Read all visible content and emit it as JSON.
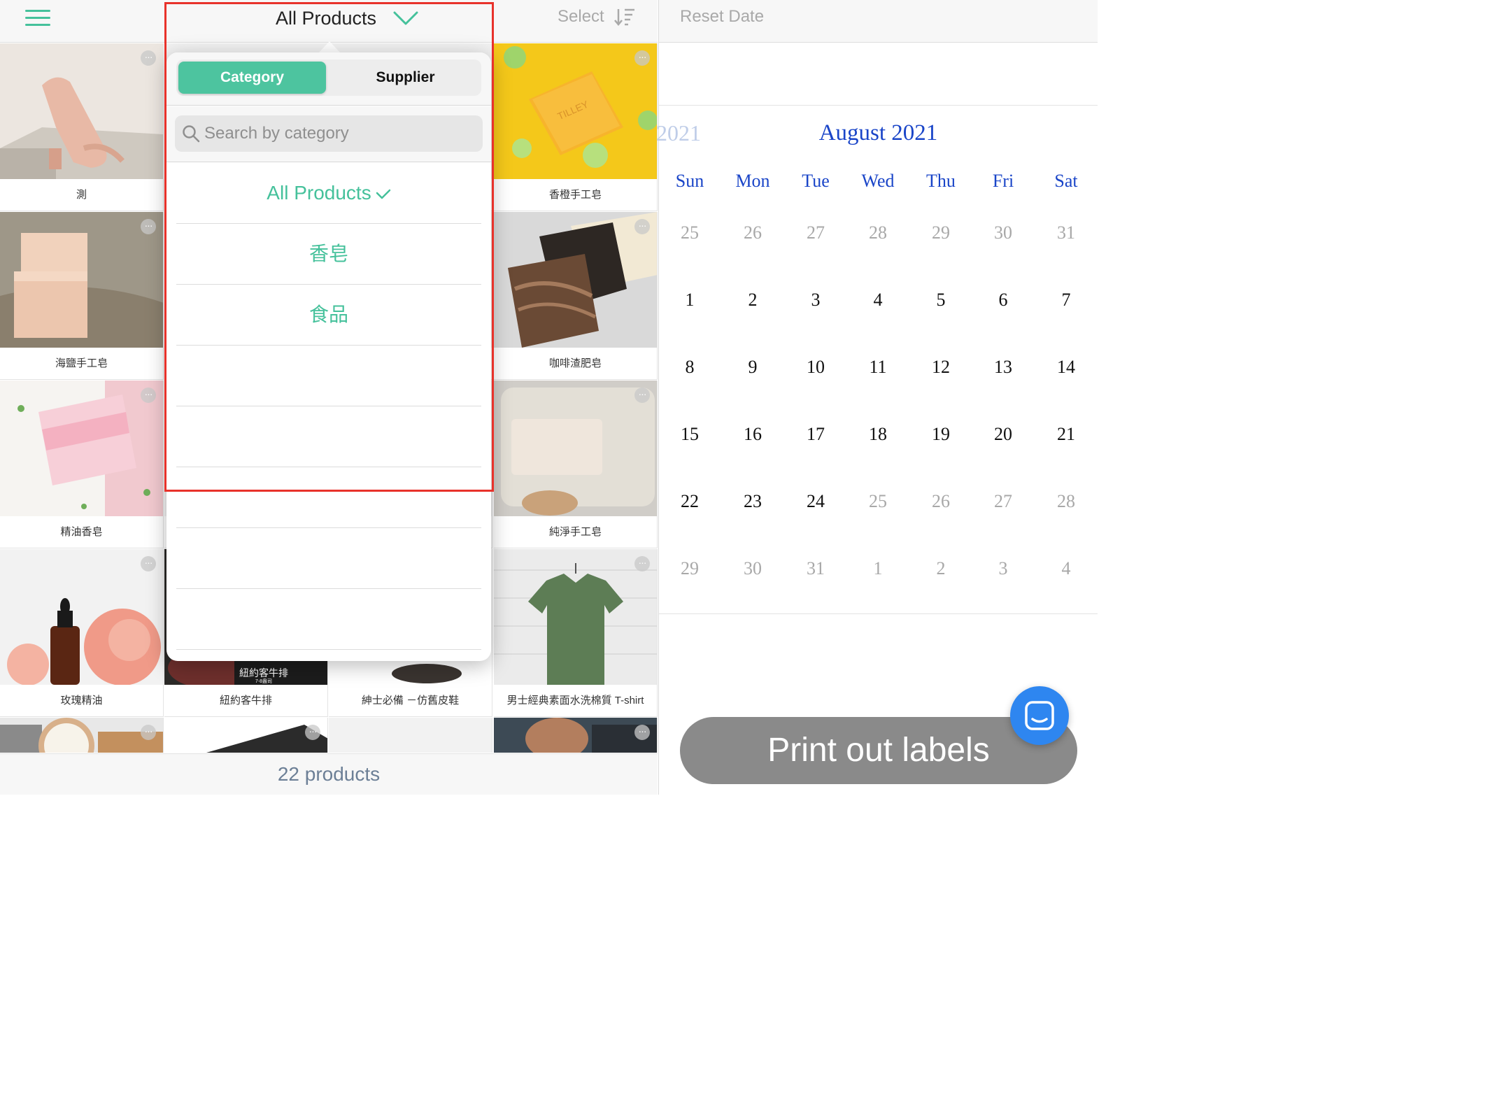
{
  "header": {
    "title": "All Products",
    "select_label": "Select"
  },
  "products": [
    {
      "name": "測",
      "img": "sandal"
    },
    {
      "name": "",
      "img": "blank"
    },
    {
      "name": "",
      "img": "blank"
    },
    {
      "name": "香橙手工皂",
      "img": "orange-soap"
    },
    {
      "name": "海鹽手工皂",
      "img": "salt-soap"
    },
    {
      "name": "",
      "img": "blank"
    },
    {
      "name": "",
      "img": "blank"
    },
    {
      "name": "咖啡渣肥皂",
      "img": "coffee-soap"
    },
    {
      "name": "精油香皂",
      "img": "pink-soap"
    },
    {
      "name": "",
      "img": "blank"
    },
    {
      "name": "",
      "img": "blank"
    },
    {
      "name": "純淨手工皂",
      "img": "pure-soap"
    },
    {
      "name": "玫瑰精油",
      "img": "rose-oil"
    },
    {
      "name": "紐約客牛排",
      "img": "steak"
    },
    {
      "name": "紳士必備 －仿舊皮鞋",
      "img": "shoes"
    },
    {
      "name": "男士經典素面水洗棉質 T-shirt",
      "img": "tshirt"
    },
    {
      "name": "",
      "img": "watch"
    },
    {
      "name": "",
      "img": "watch-dark"
    },
    {
      "name": "",
      "img": "blank"
    },
    {
      "name": "",
      "img": "hands"
    }
  ],
  "steak_label": {
    "line1": "紐約客牛排",
    "line2": "7-8盎司"
  },
  "footer": {
    "count_label": "22 products"
  },
  "popover": {
    "tabs": [
      {
        "label": "Category",
        "active": true
      },
      {
        "label": "Supplier",
        "active": false
      }
    ],
    "search_placeholder": "Search by category",
    "options": [
      {
        "label": "All Products",
        "selected": true
      },
      {
        "label": "香皂",
        "selected": false
      },
      {
        "label": "食品",
        "selected": false
      },
      {
        "label": "",
        "selected": false
      },
      {
        "label": "",
        "selected": false
      },
      {
        "label": "",
        "selected": false
      },
      {
        "label": "",
        "selected": false
      },
      {
        "label": "",
        "selected": false
      }
    ]
  },
  "calendar": {
    "reset_label": "Reset Date",
    "prev_month_fragment": "2021",
    "month_title": "August 2021",
    "weekdays": [
      "Sun",
      "Mon",
      "Tue",
      "Wed",
      "Thu",
      "Fri",
      "Sat"
    ],
    "weeks": [
      [
        {
          "d": "25",
          "muted": true
        },
        {
          "d": "26",
          "muted": true
        },
        {
          "d": "27",
          "muted": true
        },
        {
          "d": "28",
          "muted": true
        },
        {
          "d": "29",
          "muted": true
        },
        {
          "d": "30",
          "muted": true
        },
        {
          "d": "31",
          "muted": true
        }
      ],
      [
        {
          "d": "1",
          "muted": false
        },
        {
          "d": "2",
          "muted": false
        },
        {
          "d": "3",
          "muted": false
        },
        {
          "d": "4",
          "muted": false
        },
        {
          "d": "5",
          "muted": false
        },
        {
          "d": "6",
          "muted": false
        },
        {
          "d": "7",
          "muted": false
        }
      ],
      [
        {
          "d": "8",
          "muted": false
        },
        {
          "d": "9",
          "muted": false
        },
        {
          "d": "10",
          "muted": false
        },
        {
          "d": "11",
          "muted": false
        },
        {
          "d": "12",
          "muted": false
        },
        {
          "d": "13",
          "muted": false
        },
        {
          "d": "14",
          "muted": false
        }
      ],
      [
        {
          "d": "15",
          "muted": false
        },
        {
          "d": "16",
          "muted": false
        },
        {
          "d": "17",
          "muted": false
        },
        {
          "d": "18",
          "muted": false
        },
        {
          "d": "19",
          "muted": false
        },
        {
          "d": "20",
          "muted": false
        },
        {
          "d": "21",
          "muted": false
        }
      ],
      [
        {
          "d": "22",
          "muted": false
        },
        {
          "d": "23",
          "muted": false
        },
        {
          "d": "24",
          "muted": false
        },
        {
          "d": "25",
          "muted": true
        },
        {
          "d": "26",
          "muted": true
        },
        {
          "d": "27",
          "muted": true
        },
        {
          "d": "28",
          "muted": true
        }
      ],
      [
        {
          "d": "29",
          "muted": true
        },
        {
          "d": "30",
          "muted": true
        },
        {
          "d": "31",
          "muted": true
        },
        {
          "d": "1",
          "muted": true
        },
        {
          "d": "2",
          "muted": true
        },
        {
          "d": "3",
          "muted": true
        },
        {
          "d": "4",
          "muted": true
        }
      ]
    ]
  },
  "print_label": "Print out labels",
  "colors": {
    "accent": "#45c19b",
    "calendar_blue": "#1a45c8",
    "highlight": "#e8322b",
    "chat": "#2e86f0"
  }
}
